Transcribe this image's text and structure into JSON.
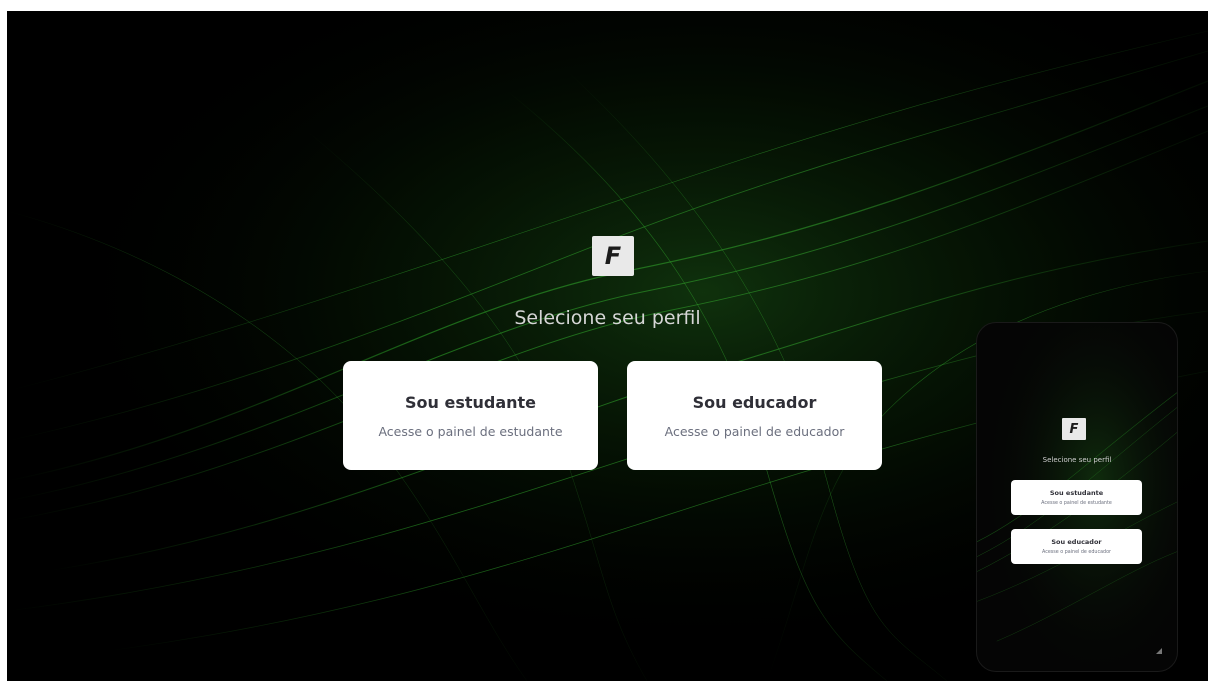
{
  "brand": {
    "logo_letter": "F"
  },
  "main": {
    "title": "Selecione seu perfil",
    "cards": [
      {
        "title": "Sou estudante",
        "subtitle": "Acesse o painel de estudante"
      },
      {
        "title": "Sou educador",
        "subtitle": "Acesse o painel de educador"
      }
    ]
  },
  "preview": {
    "title": "Selecione seu perfil",
    "cards": [
      {
        "title": "Sou estudante",
        "subtitle": "Acesse o painel de estudante"
      },
      {
        "title": "Sou educador",
        "subtitle": "Acesse o painel de educador"
      }
    ]
  },
  "colors": {
    "background": "#000000",
    "accent_green": "#2fae2a",
    "card_bg": "#ffffff",
    "card_title": "#2f2f37",
    "card_subtitle": "#6b6f7e",
    "heading": "#d6d6d6"
  },
  "icons": {
    "logo": "f-logo-icon",
    "resize": "resize-handle-icon"
  }
}
